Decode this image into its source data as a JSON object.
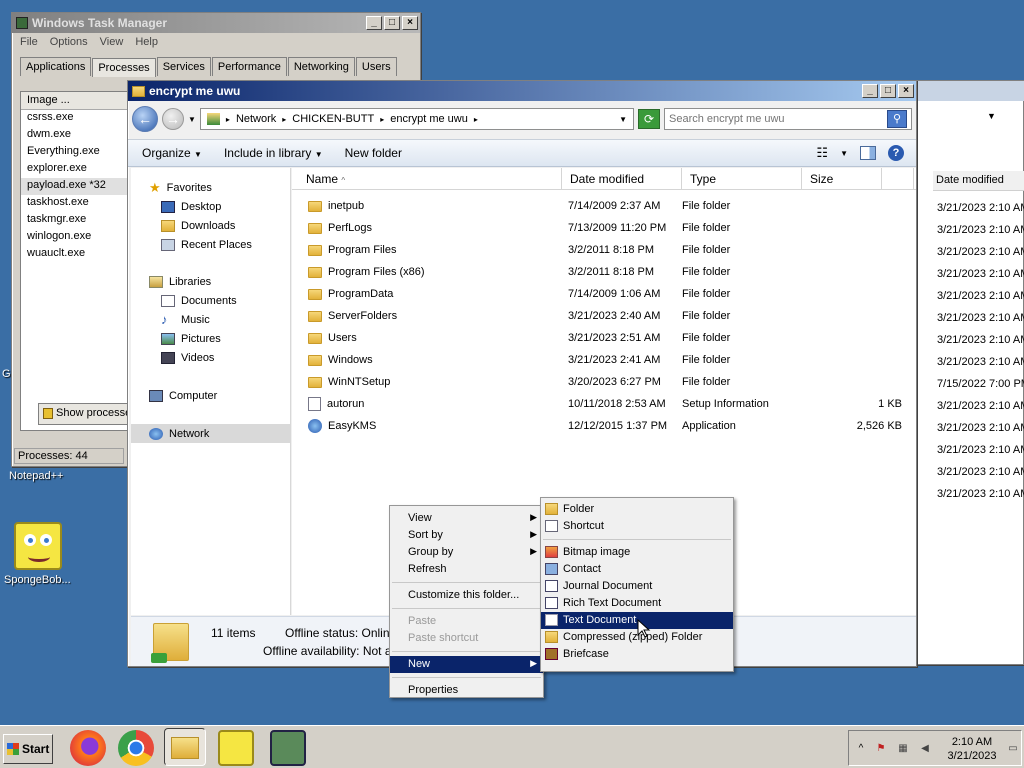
{
  "taskmgr": {
    "title": "Windows Task Manager",
    "menu": [
      "File",
      "Options",
      "View",
      "Help"
    ],
    "tabs": [
      "Applications",
      "Processes",
      "Services",
      "Performance",
      "Networking",
      "Users"
    ],
    "column_image": "Image ...",
    "processes": [
      "csrss.exe",
      "dwm.exe",
      "Everything.exe",
      "explorer.exe",
      "payload.exe *32",
      "taskhost.exe",
      "taskmgr.exe",
      "winlogon.exe",
      "wuauclt.exe"
    ],
    "show_button": "Show processes from all users",
    "status_processes": "Processes: 44"
  },
  "explorer": {
    "title": "encrypt me uwu",
    "breadcrumb": [
      "Network",
      "CHICKEN-BUTT",
      "encrypt me uwu"
    ],
    "search_placeholder": "Search encrypt me uwu",
    "commands": {
      "organize": "Organize",
      "include": "Include in library",
      "new_folder": "New folder"
    },
    "nav": {
      "favorites": "Favorites",
      "fav_items": [
        "Desktop",
        "Downloads",
        "Recent Places"
      ],
      "libraries": "Libraries",
      "lib_items": [
        "Documents",
        "Music",
        "Pictures",
        "Videos"
      ],
      "computer": "Computer",
      "network": "Network"
    },
    "columns": {
      "name": "Name",
      "date": "Date modified",
      "type": "Type",
      "size": "Size"
    },
    "files": [
      {
        "name": "inetpub",
        "date": "7/14/2009 2:37 AM",
        "type": "File folder",
        "size": ""
      },
      {
        "name": "PerfLogs",
        "date": "7/13/2009 11:20 PM",
        "type": "File folder",
        "size": ""
      },
      {
        "name": "Program Files",
        "date": "3/2/2011 8:18 PM",
        "type": "File folder",
        "size": ""
      },
      {
        "name": "Program Files (x86)",
        "date": "3/2/2011 8:18 PM",
        "type": "File folder",
        "size": ""
      },
      {
        "name": "ProgramData",
        "date": "7/14/2009 1:06 AM",
        "type": "File folder",
        "size": ""
      },
      {
        "name": "ServerFolders",
        "date": "3/21/2023 2:40 AM",
        "type": "File folder",
        "size": ""
      },
      {
        "name": "Users",
        "date": "3/21/2023 2:51 AM",
        "type": "File folder",
        "size": ""
      },
      {
        "name": "Windows",
        "date": "3/21/2023 2:41 AM",
        "type": "File folder",
        "size": ""
      },
      {
        "name": "WinNTSetup",
        "date": "3/20/2023 6:27 PM",
        "type": "File folder",
        "size": ""
      },
      {
        "name": "autorun",
        "date": "10/11/2018 2:53 AM",
        "type": "Setup Information",
        "size": "1 KB"
      },
      {
        "name": "EasyKMS",
        "date": "12/12/2015 1:37 PM",
        "type": "Application",
        "size": "2,526 KB"
      }
    ],
    "status": {
      "items": "11 items",
      "offline_status": "Offline status: Online",
      "offline_avail": "Offline availability: Not available"
    }
  },
  "explorer_bg": {
    "column_date": "Date modified",
    "dates": [
      "3/21/2023 2:10 AM",
      "3/21/2023 2:10 AM",
      "3/21/2023 2:10 AM",
      "3/21/2023 2:10 AM",
      "3/21/2023 2:10 AM",
      "3/21/2023 2:10 AM",
      "3/21/2023 2:10 AM",
      "3/21/2023 2:10 AM",
      "7/15/2022 7:00 PM",
      "3/21/2023 2:10 AM",
      "3/21/2023 2:10 AM",
      "3/21/2023 2:10 AM",
      "3/21/2023 2:10 AM",
      "3/21/2023 2:10 AM"
    ]
  },
  "context_menu": {
    "view": "View",
    "sort_by": "Sort by",
    "group_by": "Group by",
    "refresh": "Refresh",
    "customize": "Customize this folder...",
    "paste": "Paste",
    "paste_shortcut": "Paste shortcut",
    "new": "New",
    "properties": "Properties"
  },
  "new_submenu": {
    "folder": "Folder",
    "shortcut": "Shortcut",
    "bitmap": "Bitmap image",
    "contact": "Contact",
    "journal": "Journal Document",
    "rtf": "Rich Text Document",
    "text": "Text Document",
    "zip": "Compressed (zipped) Folder",
    "briefcase": "Briefcase"
  },
  "desktop": {
    "notepad": "Notepad++",
    "sponge": "SpongeBob...",
    "left_cut": "G"
  },
  "taskbar": {
    "start": "Start",
    "time": "2:10 AM",
    "date": "3/21/2023"
  },
  "colors": {
    "desktop": "#3a6ea5",
    "highlight": "#0a246a",
    "title_active": "#0a246a"
  }
}
